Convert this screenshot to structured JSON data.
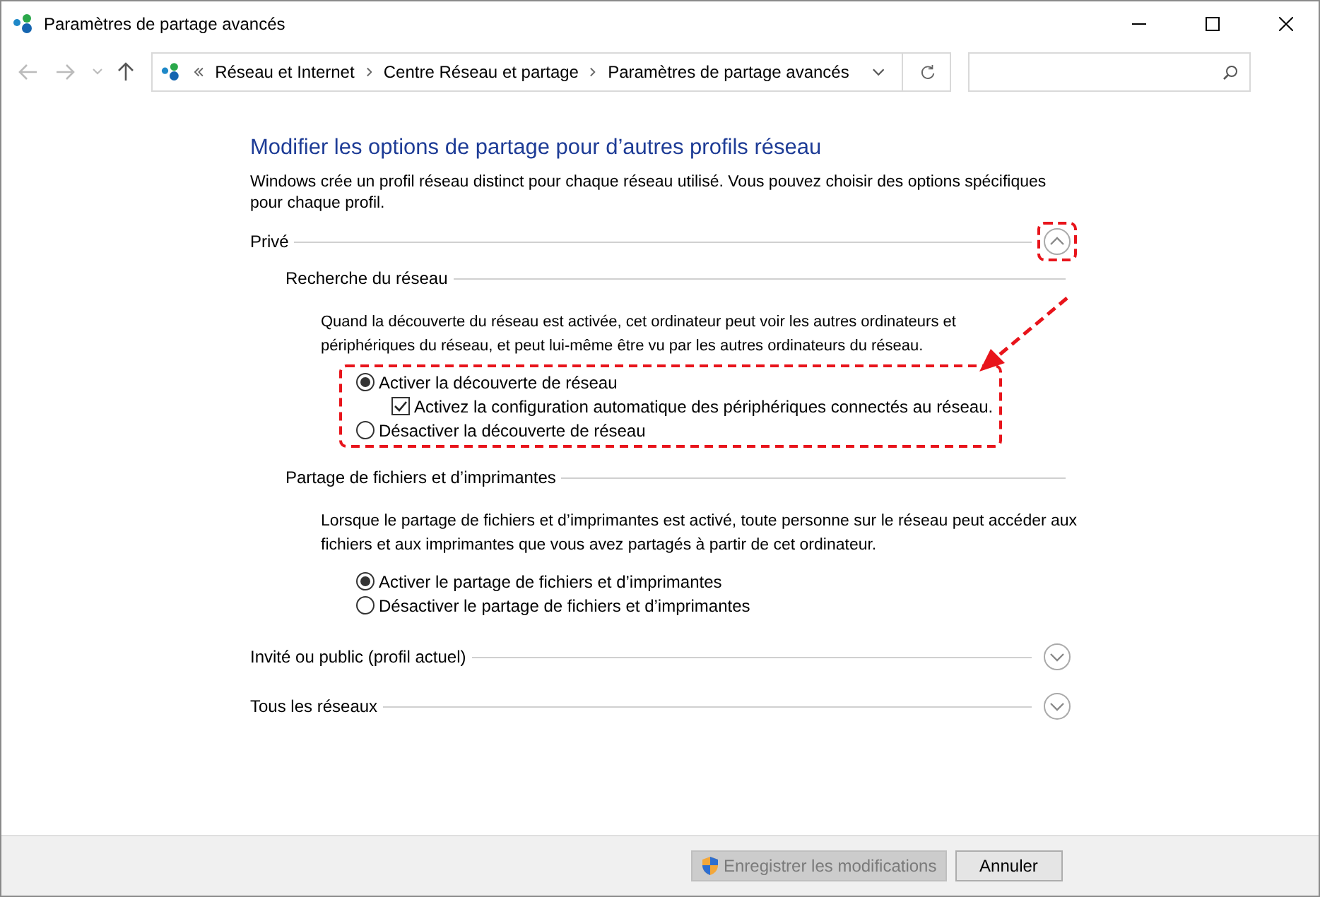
{
  "window": {
    "title": "Paramètres de partage avancés"
  },
  "address": {
    "crumbs": [
      "Réseau et Internet",
      "Centre Réseau et partage",
      "Paramètres de partage avancés"
    ]
  },
  "heading": "Modifier les options de partage pour d’autres profils réseau",
  "intro": "Windows crée un profil réseau distinct pour chaque réseau utilisé. Vous pouvez choisir des options spécifiques pour chaque profil.",
  "profiles": [
    {
      "name": "Privé",
      "expanded": true,
      "highlighted": true,
      "sections": [
        {
          "title": "Recherche du réseau",
          "description": "Quand la découverte du réseau est activée, cet ordinateur peut voir les autres ordinateurs et périphériques du réseau, et peut lui-même être vu par les autres ordinateurs du réseau.",
          "highlighted": true,
          "options": [
            {
              "label": "Activer la découverte de réseau",
              "selected": true,
              "children": [
                {
                  "label": "Activez la configuration automatique des périphériques connectés au réseau.",
                  "checked": true
                }
              ]
            },
            {
              "label": "Désactiver la découverte de réseau",
              "selected": false
            }
          ]
        },
        {
          "title": "Partage de fichiers et d’imprimantes",
          "description": "Lorsque le partage de fichiers et d’imprimantes est activé, toute personne sur le réseau peut accéder aux fichiers et aux imprimantes que vous avez partagés à partir de cet ordinateur.",
          "highlighted": false,
          "options": [
            {
              "label": "Activer le partage de fichiers et d’imprimantes",
              "selected": true
            },
            {
              "label": "Désactiver le partage de fichiers et d’imprimantes",
              "selected": false
            }
          ]
        }
      ]
    },
    {
      "name": "Invité ou public (profil actuel)",
      "expanded": false,
      "highlighted": false
    },
    {
      "name": "Tous les réseaux",
      "expanded": false,
      "highlighted": false
    }
  ],
  "buttons": [
    {
      "label": "Enregistrer les modifications",
      "kind": "elevated",
      "disabled": true
    },
    {
      "label": "Annuler",
      "kind": "plain",
      "disabled": false
    }
  ]
}
